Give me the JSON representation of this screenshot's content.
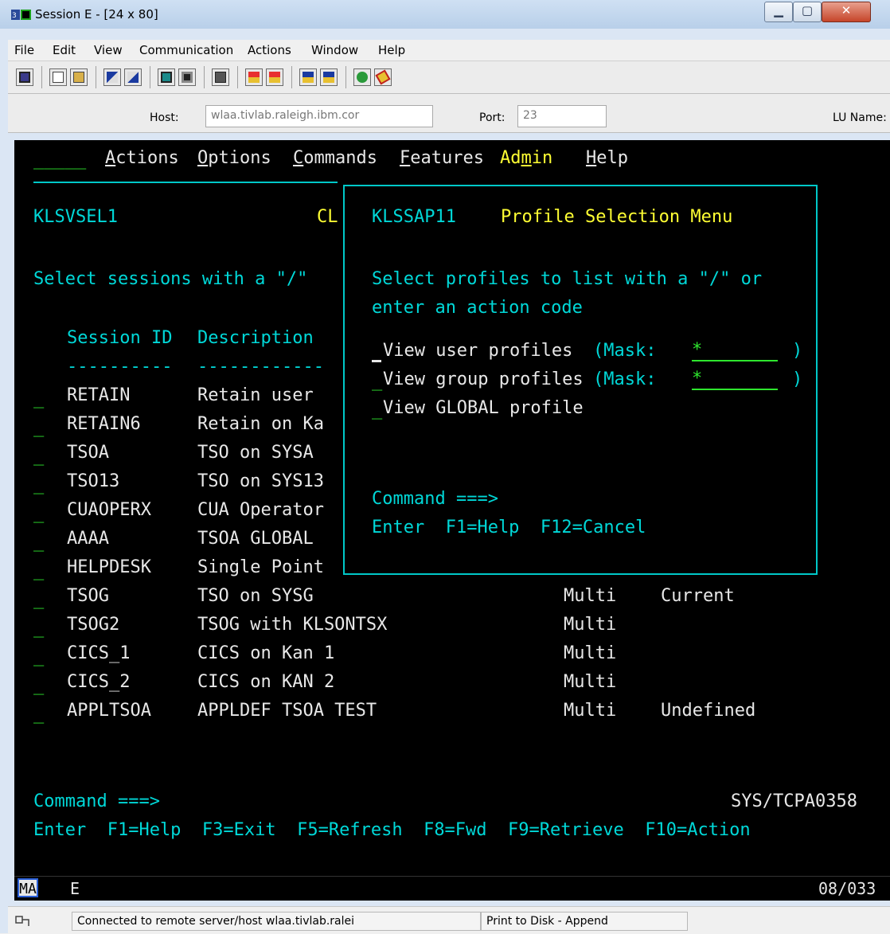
{
  "window": {
    "title": "Session E - [24 x 80]",
    "controls": {
      "minimize": "▁",
      "maximize": "▢",
      "close": "✕"
    }
  },
  "menu": [
    "File",
    "Edit",
    "View",
    "Communication",
    "Actions",
    "Window",
    "Help"
  ],
  "toolbar": {
    "icons": [
      "print-screen-icon",
      "copy-icon",
      "paste-icon",
      "send-file-icon",
      "receive-file-icon",
      "display-setup-icon",
      "color-setup-icon",
      "keyboard-map-icon",
      "macro-record-icon",
      "macro-stop-icon",
      "macro-play-icon",
      "macro-pause-icon",
      "globe-icon",
      "quick-connect-icon"
    ]
  },
  "hostbar": {
    "host_label": "Host:",
    "host_value": "wlaa.tivlab.raleigh.ibm.cor",
    "port_label": "Port:",
    "port_value": "23",
    "lu_label": "LU Name:"
  },
  "terminal": {
    "action_bar": {
      "actions": "Actions",
      "options": "Options",
      "commands": "Commands",
      "features": "Features",
      "admin": "Admin",
      "help": "Help"
    },
    "panel_id": "KLSVSEL1",
    "panel_right": "CL",
    "instruction": "Select sessions with a \"/\"",
    "col_session": "Session ID",
    "col_description": "Description",
    "col_underline_1": "----------",
    "col_underline_2": "------------",
    "rows": [
      {
        "id": "RETAIN",
        "desc": "Retain user",
        "type": "",
        "status": ""
      },
      {
        "id": "RETAIN6",
        "desc": "Retain on Ka",
        "type": "",
        "status": ""
      },
      {
        "id": "TSOA",
        "desc": "TSO on SYSA",
        "type": "",
        "status": ""
      },
      {
        "id": "TSO13",
        "desc": "TSO on SYS13",
        "type": "",
        "status": ""
      },
      {
        "id": "CUAOPERX",
        "desc": "CUA Operator",
        "type": "",
        "status": ""
      },
      {
        "id": "AAAA",
        "desc": "TSOA GLOBAL",
        "type": "",
        "status": ""
      },
      {
        "id": "HELPDESK",
        "desc": "Single Point",
        "type": "",
        "status": ""
      },
      {
        "id": "TSOG",
        "desc": "TSO on SYSG",
        "type": "Multi",
        "status": "Current"
      },
      {
        "id": "TSOG2",
        "desc": "TSOG with KLSONTSX",
        "type": "Multi",
        "status": ""
      },
      {
        "id": "CICS_1",
        "desc": "CICS on Kan 1",
        "type": "Multi",
        "status": ""
      },
      {
        "id": "CICS_2",
        "desc": "CICS on KAN 2",
        "type": "Multi",
        "status": ""
      },
      {
        "id": "APPLTSOA",
        "desc": "APPLDEF TSOA TEST",
        "type": "Multi",
        "status": "Undefined"
      }
    ],
    "command_label": "Command ===>",
    "system_id": "SYS/TCPA0358",
    "fkeys": "Enter  F1=Help  F3=Exit  F5=Refresh  F8=Fwd  F9=Retrieve  F10=Action",
    "popup": {
      "panel_id": "KLSSAP11",
      "title": "Profile Selection Menu",
      "line1": "Select profiles to list with a \"/\" or",
      "line2": "enter an action code",
      "opt1_label": "View user profiles",
      "opt1_mask_label": "(Mask:",
      "opt1_mask_value": "*",
      "opt2_label": "View group profiles",
      "opt2_mask_label": "(Mask:",
      "opt2_mask_value": "*",
      "opt3_label": "View GLOBAL profile",
      "mask_close": ")",
      "command_label": "Command ===>",
      "fkeys": "Enter  F1=Help  F12=Cancel"
    }
  },
  "oia": {
    "mode": "MA",
    "session": "E",
    "cursor_pos": "08/033"
  },
  "statusbar": {
    "connection": "Connected to remote server/host wlaa.tivlab.ralei",
    "print": "Print to Disk - Append"
  },
  "colors": {
    "terminal_bg": "#000000",
    "cyan": "#00d8d8",
    "white": "#e8e8e8",
    "yellow": "#ffff33",
    "green": "#2ee62e"
  }
}
